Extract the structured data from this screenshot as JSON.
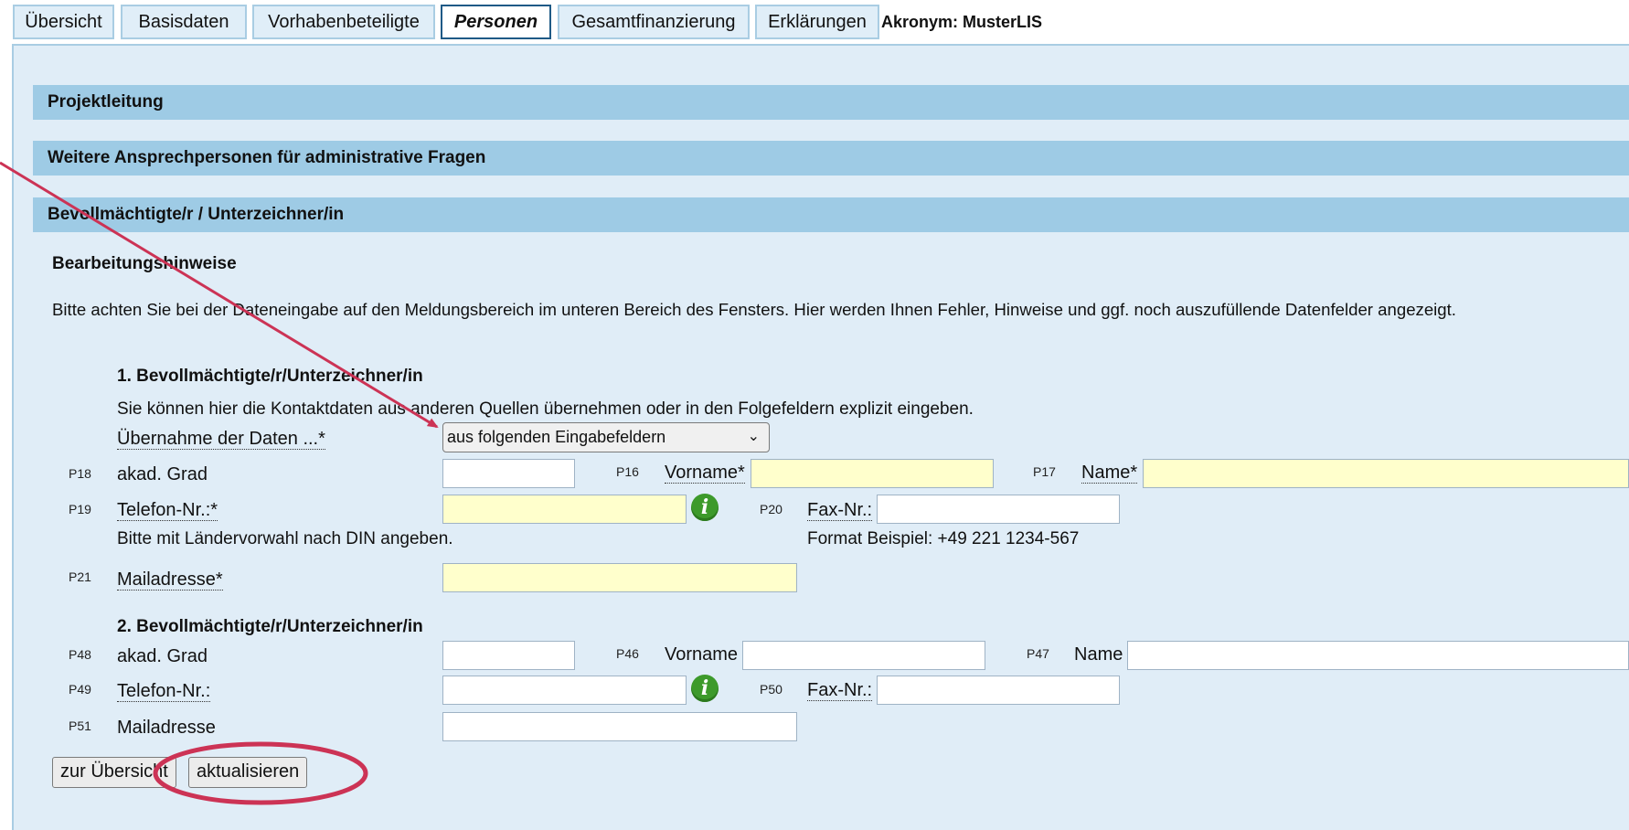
{
  "tabs": [
    {
      "label": "Übersicht"
    },
    {
      "label": "Basisdaten"
    },
    {
      "label": "Vorhabenbeteiligte"
    },
    {
      "label": "Personen",
      "active": true
    },
    {
      "label": "Gesamtfinanzierung"
    },
    {
      "label": "Erklärungen"
    }
  ],
  "akronym": "Akronym: MusterLIS",
  "sections": {
    "projektleitung": "Projektleitung",
    "weitere": "Weitere Ansprechpersonen für administrative Fragen",
    "bevollmaechtigte": "Bevollmächtigte/r / Unterzeichner/in"
  },
  "hints": {
    "title": "Bearbeitungshinweise",
    "text": "Bitte achten Sie bei der Dateneingabe auf den Meldungsbereich im unteren Bereich des Fensters. Hier werden Ihnen Fehler, Hinweise und ggf. noch auszufüllende Datenfelder angezeigt."
  },
  "person1": {
    "title": "1. Bevollmächtigte/r/Unterzeichner/in",
    "intro": "Sie können hier die Kontaktdaten aus anderen Quellen übernehmen oder in den Folgefeldern explizit eingeben.",
    "uebernahme_label": "Übernahme der Daten ...*",
    "uebernahme_value": "aus folgenden Eingabefeldern",
    "p18": "P18",
    "grad_label": "akad. Grad",
    "p16": "P16",
    "vorname_label": "Vorname*",
    "p17": "P17",
    "name_label": "Name*",
    "p19": "P19",
    "telefon_label": "Telefon-Nr.:*",
    "telefon_hint": "Bitte mit Ländervorwahl nach DIN angeben.",
    "p20": "P20",
    "fax_label": "Fax-Nr.:",
    "fax_hint": "Format Beispiel: +49 221 1234-567",
    "p21": "P21",
    "mail_label": "Mailadresse*"
  },
  "person2": {
    "title": "2. Bevollmächtigte/r/Unterzeichner/in",
    "p48": "P48",
    "grad_label": "akad. Grad",
    "p46": "P46",
    "vorname_label": "Vorname",
    "p47": "P47",
    "name_label": "Name",
    "p49": "P49",
    "telefon_label": "Telefon-Nr.:",
    "p50": "P50",
    "fax_label": "Fax-Nr.:",
    "p51": "P51",
    "mail_label": "Mailadresse"
  },
  "buttons": {
    "back": "zur Übersicht",
    "refresh": "aktualisieren"
  },
  "icons": {
    "info": "i"
  },
  "colors": {
    "section_bg": "#9ecbe5",
    "panel_bg": "#e0edf7",
    "required_field_bg": "#ffffcc",
    "annotation_red": "#cc3355"
  }
}
